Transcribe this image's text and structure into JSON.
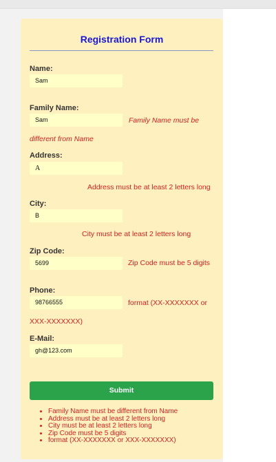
{
  "form": {
    "title": "Registration Form",
    "name": {
      "label": "Name:",
      "value": "Sam"
    },
    "family_name": {
      "label": "Family Name:",
      "value": "Sam",
      "error_line1": "Family Name must be",
      "error_line2": "different from Name"
    },
    "address": {
      "label": "Address:",
      "value": "A",
      "error": "Address must be at least 2 letters long"
    },
    "city": {
      "label": "City:",
      "value": "B",
      "error": "City must be at least 2 letters long"
    },
    "zip": {
      "label": "Zip Code:",
      "value": "5699",
      "error": "Zip Code must be 5 digits"
    },
    "phone": {
      "label": "Phone:",
      "value": "98766555",
      "error_line1": "format (XX-XXXXXXX or",
      "error_line2": "XXX-XXXXXXX)"
    },
    "email": {
      "label": "E-Mail:",
      "value": "gh@123.com"
    },
    "submit_label": "Submit"
  },
  "errors_summary": [
    "Family Name must be different from Name",
    "Address must be at least 2 letters long",
    "City must be at least 2 letters long",
    "Zip Code must be 5 digits",
    "format (XX-XXXXXXX or XXX-XXXXXXX)"
  ]
}
